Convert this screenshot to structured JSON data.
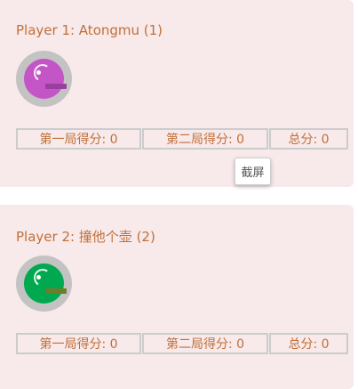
{
  "players": [
    {
      "title": "Player 1: Atongmu (1)",
      "stone_color": "#c455c6",
      "stone_bar_color": "#9a3fa0",
      "scores": {
        "round1": "第一局得分: 0",
        "round2": "第二局得分: 0",
        "total": "总分: 0"
      }
    },
    {
      "title": "Player 2: 撞他个壶 (2)",
      "stone_color": "#00a94f",
      "stone_bar_color": "#6e7d2a",
      "scores": {
        "round1": "第一局得分: 0",
        "round2": "第二局得分: 0",
        "total": "总分: 0"
      }
    }
  ],
  "tooltip": {
    "label": "截屏"
  },
  "colors": {
    "card_bg": "#f8e9ea",
    "text_accent": "#c0703a",
    "border": "#cccccc",
    "stone_ring": "#c3c3c3"
  }
}
